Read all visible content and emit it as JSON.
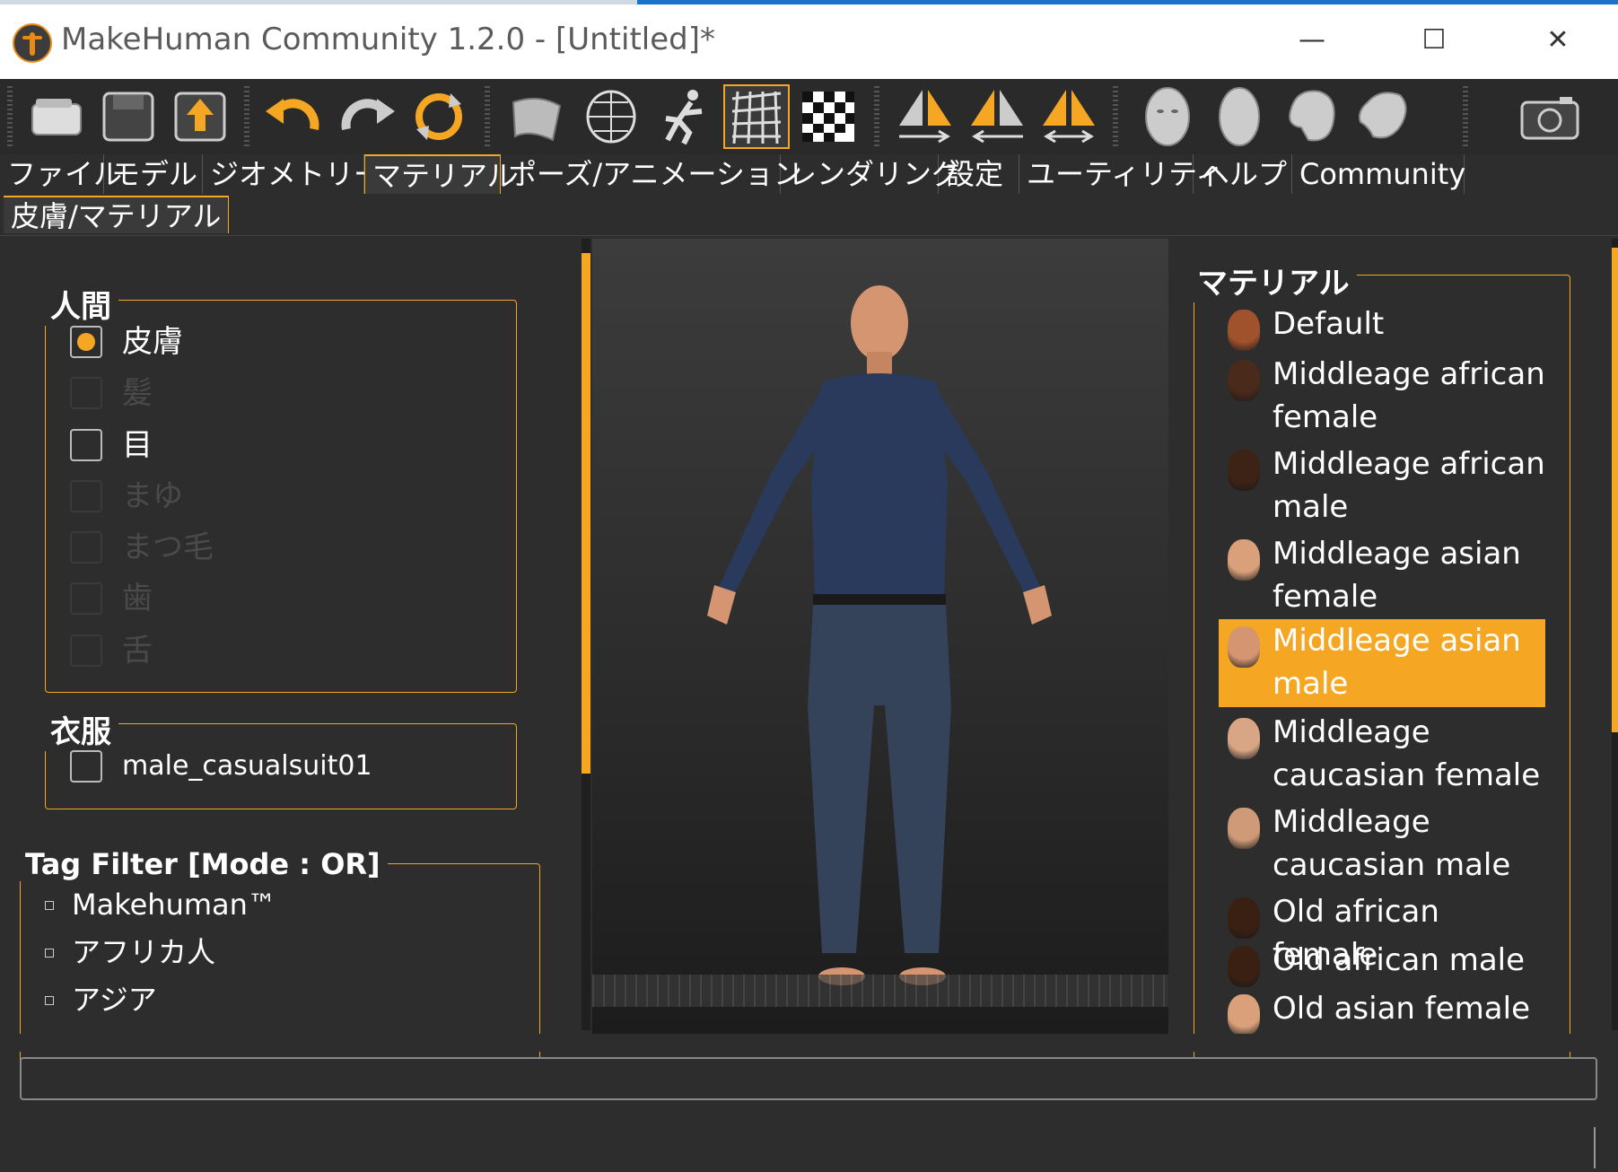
{
  "window": {
    "title": "MakeHuman Community 1.2.0 - [Untitled]*",
    "min_glyph": "—",
    "max_glyph": "☐",
    "close_glyph": "✕"
  },
  "toolbar": {
    "icons": [
      "open-file-icon",
      "save-icon",
      "export-icon",
      "undo-icon",
      "redo-icon",
      "reset-icon",
      "smooth-icon",
      "wireframe-icon",
      "pose-icon",
      "grid-icon",
      "background-checker-icon",
      "symmetry-right-icon",
      "symmetry-left-icon",
      "symmetry-icon",
      "front-view-icon",
      "side-view-icon",
      "top-view-icon",
      "three-quarter-view-icon",
      "screenshot-icon"
    ],
    "active_icon": "grid-icon"
  },
  "tabs": [
    {
      "label": "ファイル"
    },
    {
      "label": "モデル"
    },
    {
      "label": "ジオメトリー"
    },
    {
      "label": "マテリアル"
    },
    {
      "label": "ポーズ/アニメーション"
    },
    {
      "label": "レンダリング"
    },
    {
      "label": "設定"
    },
    {
      "label": "ユーティリティ"
    },
    {
      "label": "ヘルプ"
    },
    {
      "label": "Community"
    }
  ],
  "active_tab": "マテリアル",
  "subtab": {
    "label": "皮膚/マテリアル"
  },
  "human_group": {
    "title": "人間",
    "items": [
      {
        "label": "皮膚",
        "checked": true,
        "enabled": true
      },
      {
        "label": "髪",
        "checked": false,
        "enabled": false
      },
      {
        "label": "目",
        "checked": false,
        "enabled": true
      },
      {
        "label": "まゆ",
        "checked": false,
        "enabled": false
      },
      {
        "label": "まつ毛",
        "checked": false,
        "enabled": false
      },
      {
        "label": "歯",
        "checked": false,
        "enabled": false
      },
      {
        "label": "舌",
        "checked": false,
        "enabled": false
      }
    ]
  },
  "clothes_group": {
    "title": "衣服",
    "items": [
      {
        "label": "male_casualsuit01",
        "checked": false
      }
    ]
  },
  "tag_filter": {
    "title": "Tag Filter [Mode : OR]",
    "items": [
      {
        "label": "Makehuman™"
      },
      {
        "label": "アフリカ人"
      },
      {
        "label": "アジア"
      }
    ]
  },
  "material_group": {
    "title": "マテリアル",
    "items": [
      {
        "label": "Default",
        "selected": false,
        "skin": "#a0522d"
      },
      {
        "label": "Middleage african female",
        "selected": false,
        "skin": "#4a2a1a"
      },
      {
        "label": "Middleage african male",
        "selected": false,
        "skin": "#3d2315"
      },
      {
        "label": "Middleage asian female",
        "selected": false,
        "skin": "#d9a07a"
      },
      {
        "label": "Middleage asian male",
        "selected": true,
        "skin": "#d49570"
      },
      {
        "label": "Middleage caucasian female",
        "selected": false,
        "skin": "#d8a585"
      },
      {
        "label": "Middleage caucasian male",
        "selected": false,
        "skin": "#cf9a78"
      },
      {
        "label": "Old african female",
        "selected": false,
        "skin": "#3a2012"
      },
      {
        "label": "Old african male",
        "selected": false,
        "skin": "#3a2012"
      },
      {
        "label": "Old asian female",
        "selected": false,
        "skin": "#d9a07a"
      }
    ]
  },
  "colors": {
    "accent": "#f5a623",
    "background": "#2d2d2d",
    "shirt": "#2a3a5c",
    "jeans": "#34425a",
    "skin": "#d49570"
  },
  "statusbar": {
    "text": ""
  }
}
